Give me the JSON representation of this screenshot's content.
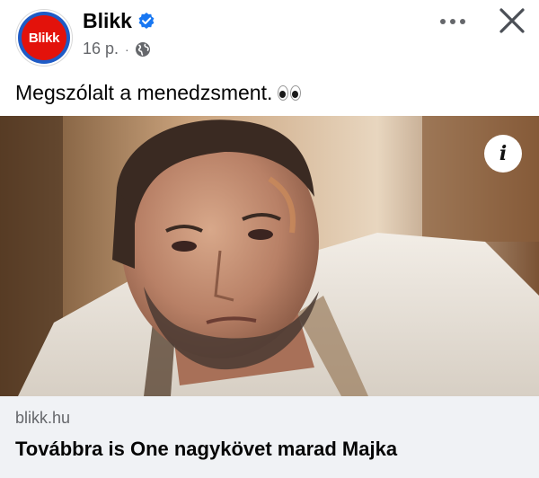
{
  "post": {
    "page_name": "Blikk",
    "avatar_text": "Blikk",
    "time": "16 p.",
    "separator": "·",
    "text": "Megszólalt a menedzsment.",
    "emoji_icon": "eyes-icon"
  },
  "link_preview": {
    "domain": "blikk.hu",
    "title": "Továbbra is One nagykövet marad Majka",
    "info_label": "i"
  },
  "icons": {
    "verified": "verified-badge-icon",
    "audience": "globe-icon",
    "more": "more-options-icon",
    "close": "close-icon"
  },
  "colors": {
    "brand_red": "#e3120b",
    "verified_blue": "#1877f2",
    "secondary_text": "#65676b",
    "card_background": "#f0f2f5"
  }
}
